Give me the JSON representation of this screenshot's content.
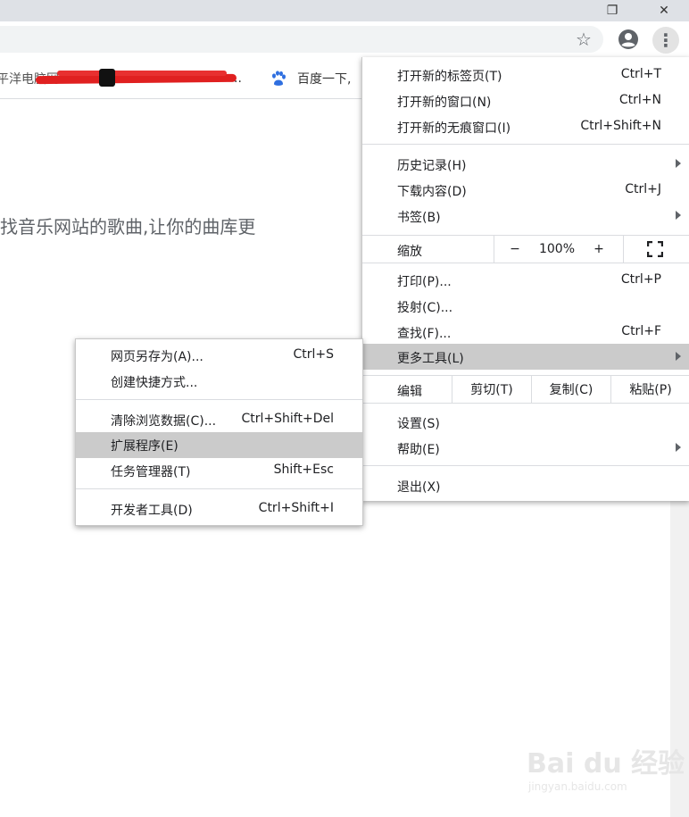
{
  "window": {
    "restore_glyph": "❐",
    "close_glyph": "✕"
  },
  "toolbar": {
    "star_glyph": "☆",
    "menu_glyph": "⋮"
  },
  "bookmarks": {
    "first_fragment": "平洋电脑网",
    "baidu_label": "百度一下,",
    "ellipsis": ".."
  },
  "page": {
    "visible_text": "找音乐网站的歌曲,让你的曲库更"
  },
  "menu": {
    "items_top": [
      {
        "label": "打开新的标签页(T)",
        "shortcut": "Ctrl+T"
      },
      {
        "label": "打开新的窗口(N)",
        "shortcut": "Ctrl+N"
      },
      {
        "label": "打开新的无痕窗口(I)",
        "shortcut": "Ctrl+Shift+N"
      }
    ],
    "items_history": [
      {
        "label": "历史记录(H)",
        "shortcut": ""
      },
      {
        "label": "下载内容(D)",
        "shortcut": "Ctrl+J"
      },
      {
        "label": "书签(B)",
        "shortcut": ""
      }
    ],
    "zoom": {
      "label": "缩放",
      "minus": "−",
      "value": "100%",
      "plus": "+",
      "fullscreen_glyph": "⛶"
    },
    "items_tools": [
      {
        "label": "打印(P)...",
        "shortcut": "Ctrl+P"
      },
      {
        "label": "投射(C)...",
        "shortcut": ""
      },
      {
        "label": "查找(F)...",
        "shortcut": "Ctrl+F"
      },
      {
        "label": "更多工具(L)",
        "shortcut": ""
      }
    ],
    "edit": {
      "label": "编辑",
      "cut": "剪切(T)",
      "copy": "复制(C)",
      "paste": "粘贴(P)"
    },
    "items_settings": [
      {
        "label": "设置(S)",
        "shortcut": ""
      },
      {
        "label": "帮助(E)",
        "shortcut": ""
      }
    ],
    "exit": {
      "label": "退出(X)"
    }
  },
  "submenu": {
    "items": [
      {
        "label": "网页另存为(A)...",
        "shortcut": "Ctrl+S"
      },
      {
        "label": "创建快捷方式...",
        "shortcut": ""
      },
      {
        "label": "清除浏览数据(C)...",
        "shortcut": "Ctrl+Shift+Del"
      },
      {
        "label": "扩展程序(E)",
        "shortcut": ""
      },
      {
        "label": "任务管理器(T)",
        "shortcut": "Shift+Esc"
      },
      {
        "label": "开发者工具(D)",
        "shortcut": "Ctrl+Shift+I"
      }
    ]
  },
  "watermark": {
    "brand": "Bai du 经验",
    "url": "jingyan.baidu.com"
  }
}
